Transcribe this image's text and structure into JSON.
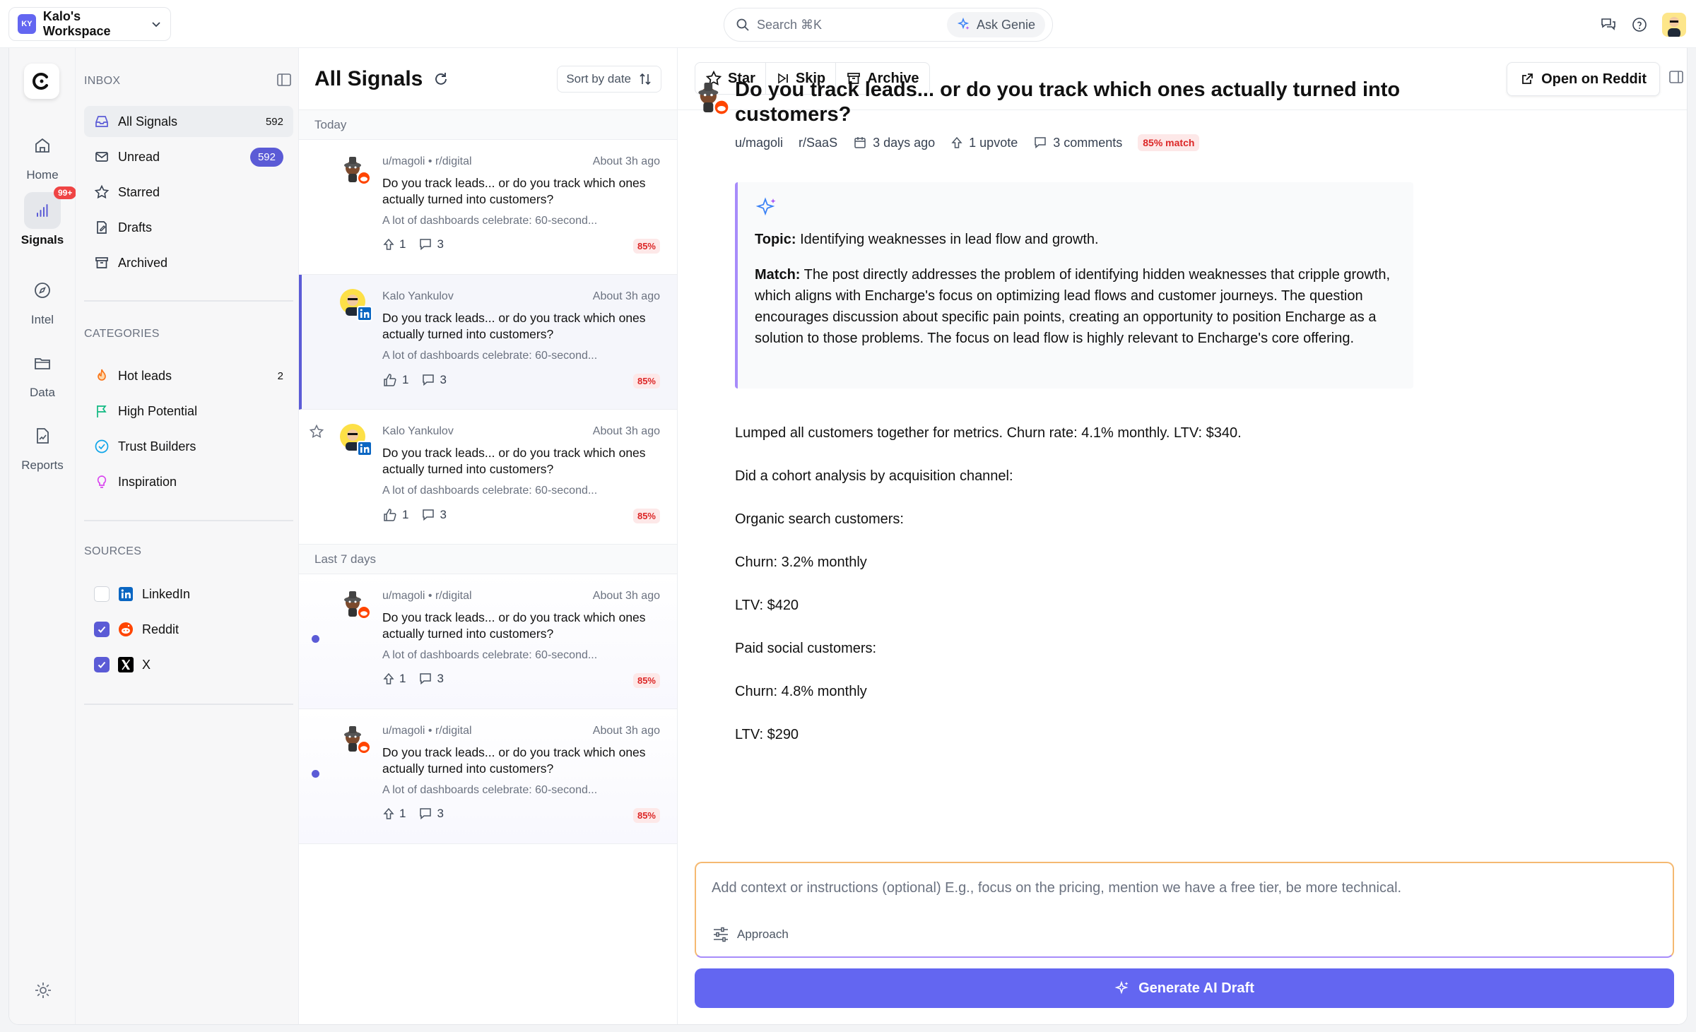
{
  "workspace": {
    "initials": "KY",
    "name": "Kalo's Workspace"
  },
  "search": {
    "placeholder": "Search ⌘K",
    "genie_label": "Ask Genie"
  },
  "rail": {
    "items": [
      {
        "label": "Home",
        "icon": "home-icon"
      },
      {
        "label": "Signals",
        "icon": "signals-icon",
        "badge": "99+"
      },
      {
        "label": "Intel",
        "icon": "compass-icon"
      },
      {
        "label": "Data",
        "icon": "folder-icon"
      },
      {
        "label": "Reports",
        "icon": "report-icon"
      }
    ]
  },
  "sidebar": {
    "inbox_title": "INBOX",
    "inbox": [
      {
        "label": "All Signals",
        "count": "592"
      },
      {
        "label": "Unread",
        "count": "592"
      },
      {
        "label": "Starred",
        "count": ""
      },
      {
        "label": "Drafts",
        "count": ""
      },
      {
        "label": "Archived",
        "count": ""
      }
    ],
    "categories_title": "CATEGORIES",
    "categories": [
      {
        "label": "Hot leads",
        "count": "2",
        "color": "#f97316"
      },
      {
        "label": "High Potential",
        "count": "",
        "color": "#10b981"
      },
      {
        "label": "Trust Builders",
        "count": "",
        "color": "#0ea5e9"
      },
      {
        "label": "Inspiration",
        "count": "",
        "color": "#d946ef"
      }
    ],
    "sources_title": "SOURCES",
    "sources": [
      {
        "label": "LinkedIn",
        "checked": false
      },
      {
        "label": "Reddit",
        "checked": true
      },
      {
        "label": "X",
        "checked": true
      }
    ]
  },
  "list": {
    "title": "All Signals",
    "sort_label": "Sort by date",
    "groups": [
      "Today",
      "Last 7 days"
    ],
    "cards": [
      {
        "author": "u/magoli • r/digital",
        "time": "About 3h ago",
        "title": "Do you track leads... or do you track which ones actually turned into customers?",
        "snippet": "A lot of dashboards celebrate: 60-second...",
        "upvotes": "1",
        "comments": "3",
        "match": "85%"
      },
      {
        "author": "Kalo Yankulov",
        "time": "About 3h ago",
        "title": "Do you track leads... or do you track which ones actually turned into customers?",
        "snippet": "A lot of dashboards celebrate: 60-second...",
        "upvotes": "1",
        "comments": "3",
        "match": "85%"
      },
      {
        "author": "Kalo Yankulov",
        "time": "About 3h ago",
        "title": "Do you track leads... or do you track which ones actually turned into customers?",
        "snippet": "A lot of dashboards celebrate: 60-second...",
        "upvotes": "1",
        "comments": "3",
        "match": "85%"
      },
      {
        "author": "u/magoli • r/digital",
        "time": "About 3h ago",
        "title": "Do you track leads... or do you track which ones actually turned into customers?",
        "snippet": "A lot of dashboards celebrate: 60-second...",
        "upvotes": "1",
        "comments": "3",
        "match": "85%"
      },
      {
        "author": "u/magoli • r/digital",
        "time": "About 3h ago",
        "title": "Do you track leads... or do you track which ones actually turned into customers?",
        "snippet": "A lot of dashboards celebrate: 60-second...",
        "upvotes": "1",
        "comments": "3",
        "match": "85%"
      }
    ]
  },
  "detail": {
    "toolbar": {
      "star": "Star",
      "skip": "Skip",
      "archive": "Archive",
      "open": "Open on Reddit"
    },
    "title": "Do you track leads... or do you track which ones actually turned into customers?",
    "author": "u/magoli",
    "subreddit": "r/SaaS",
    "date": "3 days ago",
    "upvotes": "1 upvote",
    "comments": "3 comments",
    "match": "85% match",
    "topic_label": "Topic:",
    "topic": "Identifying weaknesses in lead flow and growth.",
    "match_label": "Match:",
    "match_text": "The post directly addresses the problem of identifying hidden weaknesses that cripple growth, which aligns with Encharge's focus on optimizing lead flows and customer journeys. The question encourages discussion about specific pain points, creating an opportunity to position Encharge as a solution to those problems. The focus on lead flow is highly relevant to Encharge's core offering.",
    "body": [
      "Lumped all customers together for metrics. Churn rate: 4.1% monthly. LTV: $340.",
      "Did a cohort analysis by acquisition channel:",
      "Organic search customers:",
      "Churn: 3.2% monthly",
      "LTV: $420",
      "Paid social customers:",
      "Churn: 4.8% monthly",
      "LTV: $290"
    ],
    "composer_placeholder": "Add context or instructions (optional)  E.g., focus on the pricing, mention we have a free tier, be more technical.",
    "approach_label": "Approach",
    "generate_label": "Generate AI Draft"
  }
}
